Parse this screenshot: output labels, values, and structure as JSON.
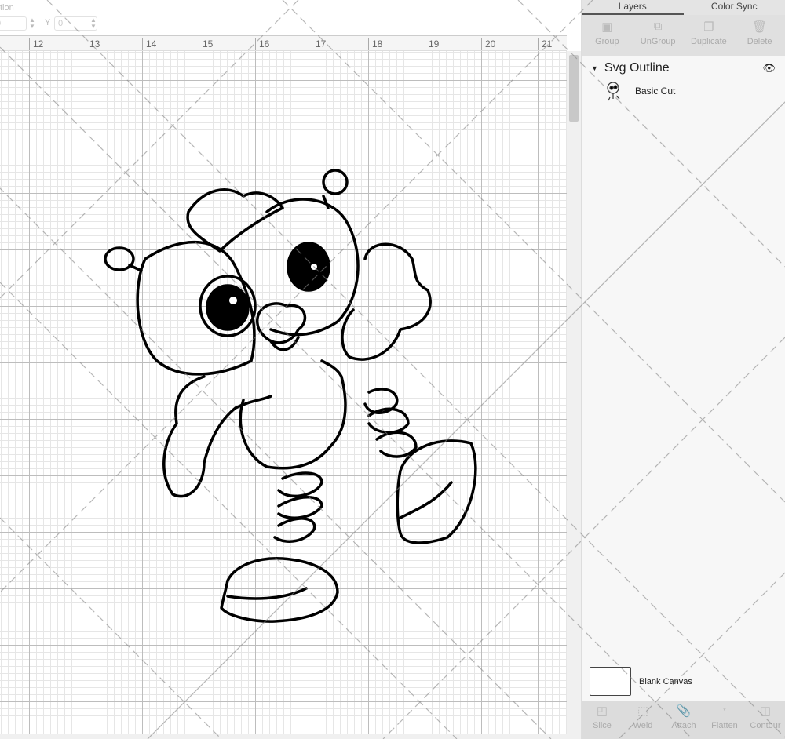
{
  "toolbar": {
    "position_label": "tion",
    "x_value": "0",
    "y_label": "Y",
    "y_value": "0"
  },
  "ruler": {
    "labels": [
      "12",
      "13",
      "14",
      "15",
      "16",
      "17",
      "18",
      "19",
      "20",
      "21"
    ]
  },
  "panel": {
    "tabs": [
      {
        "label": "Layers",
        "active": true
      },
      {
        "label": "Color Sync",
        "active": false
      }
    ],
    "tools": [
      {
        "label": "Group",
        "icon": "group-icon"
      },
      {
        "label": "UnGroup",
        "icon": "ungroup-icon"
      },
      {
        "label": "Duplicate",
        "icon": "duplicate-icon"
      },
      {
        "label": "Delete",
        "icon": "trash-icon"
      }
    ],
    "group_name": "Svg Outline",
    "layer_name": "Basic Cut",
    "blank_canvas": "Blank Canvas",
    "bottom_tools": [
      {
        "label": "Slice",
        "icon": "slice-icon"
      },
      {
        "label": "Weld",
        "icon": "weld-icon"
      },
      {
        "label": "Attach",
        "icon": "paperclip-icon"
      },
      {
        "label": "Flatten",
        "icon": "flatten-icon"
      },
      {
        "label": "Contour",
        "icon": "contour-icon"
      }
    ]
  }
}
